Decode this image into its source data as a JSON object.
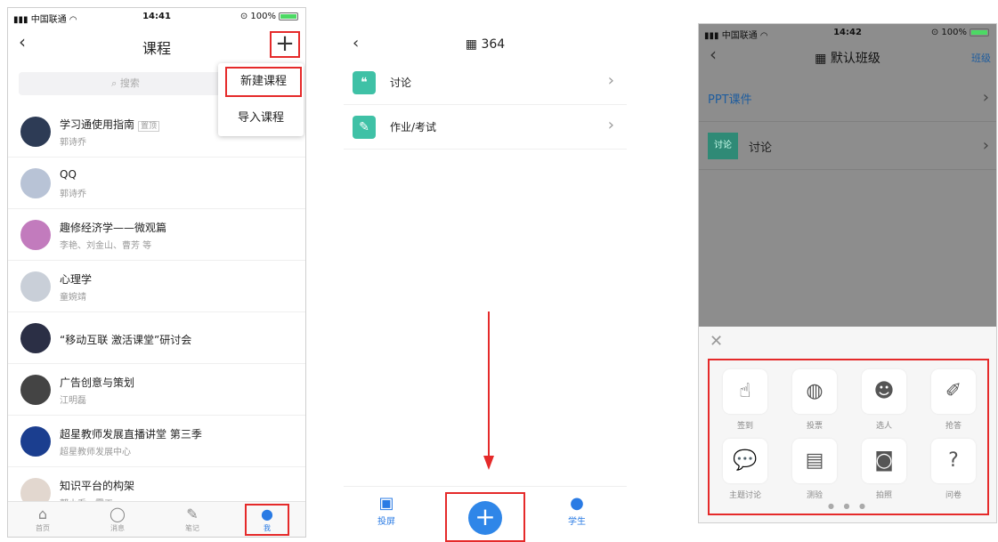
{
  "panel1": {
    "status": {
      "carrier": "中国联通",
      "time": "14:41",
      "battery": "100%"
    },
    "title": "课程",
    "search_placeholder": "搜索",
    "menu": [
      "新建课程",
      "导入课程"
    ],
    "courses": [
      {
        "title": "学习通使用指南",
        "tag": "置顶",
        "sub": "郭诗乔",
        "color": "#2d3b55"
      },
      {
        "title": "QQ",
        "tag": "",
        "sub": "郭诗乔",
        "color": "#b8c3d6"
      },
      {
        "title": "趣修经济学——微观篇",
        "tag": "",
        "sub": "李艳、刘金山、曹芳 等",
        "color": "#c27bbd"
      },
      {
        "title": "心理学",
        "tag": "",
        "sub": "童婉靖",
        "color": "#c9cfd8"
      },
      {
        "title": "“移动互联 激活课堂”研讨会",
        "tag": "",
        "sub": "",
        "color": "#2b2f45"
      },
      {
        "title": "广告创意与策划",
        "tag": "",
        "sub": "江明磊",
        "color": "#444"
      },
      {
        "title": "超星教师发展直播讲堂 第三季",
        "tag": "",
        "sub": "超星教师发展中心",
        "color": "#1b3e8f"
      },
      {
        "title": "知识平台的构架",
        "tag": "",
        "sub": "郭小乔—雾工",
        "color": "#e2d7cf"
      }
    ],
    "tabs": [
      "首页",
      "消息",
      "笔记",
      "我"
    ]
  },
  "panel2": {
    "title": "364",
    "items": [
      "讨论",
      "作业/考试"
    ],
    "tabs": {
      "left": "投屏",
      "right": "学生"
    }
  },
  "panel3": {
    "status": {
      "carrier": "中国联通",
      "time": "14:42",
      "battery": "100%"
    },
    "title": "默认班级",
    "right_link": "班级",
    "rows": [
      "PPT课件",
      "讨论"
    ],
    "badge": "讨论",
    "grid": [
      "签到",
      "投票",
      "选人",
      "抢答",
      "主题讨论",
      "测验",
      "拍照",
      "问卷"
    ]
  },
  "colors": {
    "accent_red": "#e52a2a",
    "blue": "#2f86e8",
    "teal": "#3fc1a6"
  }
}
